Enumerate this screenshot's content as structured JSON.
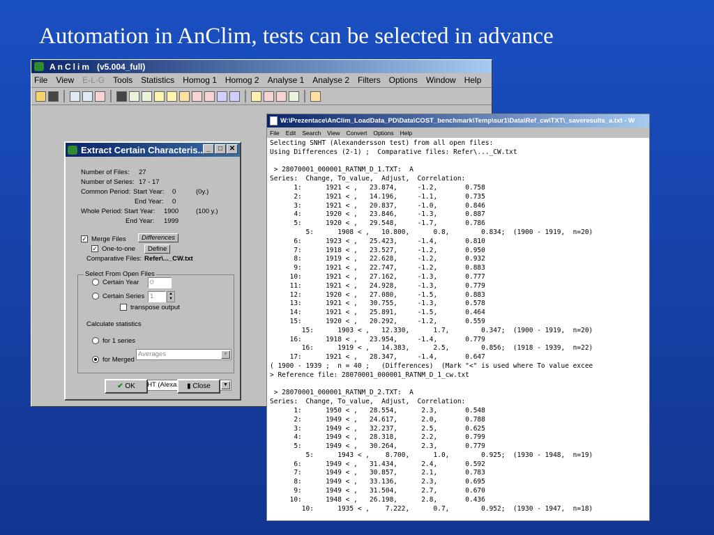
{
  "slide_title": "Automation in AnClim, tests can be selected in advance",
  "app": {
    "title_name": "AnClim",
    "title_version": "(v5.004_full)",
    "menu": [
      "File",
      "View",
      "E-L-G",
      "Tools",
      "Statistics",
      "Homog 1",
      "Homog 2",
      "Analyse 1",
      "Analyse 2",
      "Filters",
      "Options",
      "Window",
      "Help"
    ],
    "toolbar_icons": [
      "open-icon",
      "save-icon",
      "table-icon",
      "chart-icon",
      "tools-icon",
      "calculator-icon",
      "line-chart-icon",
      "graph-icon",
      "ae-icon",
      "bar-icon",
      "histogram-icon",
      "spectrum-icon",
      "grid-icon",
      "copy-icon",
      "map-icon",
      "wave-icon",
      "trend-icon",
      "monitor-icon",
      "exit-icon"
    ]
  },
  "dialog": {
    "title": "Extract Certain Characteris...",
    "number_of_files_label": "Number of Files:",
    "number_of_files": "27",
    "number_of_series_label": "Number of Series:",
    "number_of_series": "17 - 17",
    "common_period_label": "Common Period:",
    "start_year_label": "Start Year:",
    "common_start": "0",
    "common_span": "(0y.)",
    "end_year_label": "End Year:",
    "common_end": "0",
    "whole_period_label": "Whole Period:",
    "whole_start": "1900",
    "whole_span": "(100 y.)",
    "whole_end": "1999",
    "merge_files_label": "Merge Files",
    "differences_button": "Differences",
    "one_to_one_label": "One-to-one",
    "define_button": "Define",
    "comparative_files_label": "Comparative Files:",
    "comparative_files_value": "Refer\\..._CW.txt",
    "select_group_label": "Select From Open Files",
    "certain_year_label": "Certain Year",
    "certain_year_value": "0",
    "certain_series_label": "Certain Series",
    "certain_series_value": "1",
    "transpose_label": "transpose output",
    "calc_stats_label": "Calculate statistics",
    "for1_label": "for 1 series",
    "for1_value": "Averages",
    "merged_label": "for Merged",
    "merged_value": "SNHT (Alexandersson test)",
    "ok_label": "OK",
    "close_label": "Close"
  },
  "text_window": {
    "title": "W:\\Prezentace\\AnClim_LoadData_PD\\Data\\COST_benchmark\\Temp\\sur1\\Data\\Ref_cw\\TXT\\_saveresults_a.txt - W",
    "menu": [
      "File",
      "Edit",
      "Search",
      "View",
      "Convert",
      "Options",
      "Help"
    ],
    "content": "Selecting SNHT (Alexandersson test) from all open files:\nUsing Differences (2-1) ;  Comparative files: Refer\\..._CW.txt\n\n > 28070001_000001_RATNM_D_1.TXT:  A\nSeries:  Change, To_value,  Adjust,  Correlation:\n      1:      1921 < ,   23.874,     -1.2,       0.758\n      2:      1921 < ,   14.196,     -1.1,       0.735\n      3:      1921 < ,   20.837,     -1.0,       0.846\n      4:      1920 < ,   23.846,     -1.3,       0.887\n      5:      1920 < ,   29.548,     -1.7,       0.786\n         5:      1908 < ,   10.800,      0.8,        0.834;  (1900 - 1919,  n=20)\n      6:      1923 < ,   25.423,     -1.4,       0.810\n      7:      1918 < ,   23.527,     -1.2,       0.950\n      8:      1919 < ,   22.628,     -1.2,       0.932\n      9:      1921 < ,   22.747,     -1.2,       0.883\n     10:      1921 < ,   27.162,     -1.3,       0.777\n     11:      1921 < ,   24.928,     -1.3,       0.779\n     12:      1920 < ,   27.080,     -1.5,       0.883\n     13:      1921 < ,   30.755,     -1.3,       0.578\n     14:      1921 < ,   25.891,     -1.5,       0.464\n     15:      1920 < ,   20.292,     -1.2,       0.559\n        15:      1903 < ,   12.330,      1.7,        0.347;  (1900 - 1919,  n=20)\n     16:      1918 < ,   23.954,     -1.4,       0.779\n        16:      1919 < ,   14.383,      2.5,        0.856;  (1918 - 1939,  n=22)\n     17:      1921 < ,   28.347,     -1.4,       0.647\n( 1900 - 1939 ;  n = 40 ;   (Differences)  (Mark \"<\" is used where To value excee\n> Reference file: 28070001_000001_RATNM_D_1_cw.txt\n\n > 28070001_000001_RATNM_D_2.TXT:  A\nSeries:  Change, To_value,  Adjust,  Correlation:\n      1:      1950 < ,   28.554,      2.3,       0.548\n      2:      1949 < ,   24.617,      2.0,       0.788\n      3:      1949 < ,   32.237,      2.5,       0.625\n      4:      1949 < ,   28.318,      2.2,       0.799\n      5:      1949 < ,   30.264,      2.3,       0.779\n         5:      1943 < ,    8.700,      1.0,        0.925;  (1930 - 1948,  n=19)\n      6:      1949 < ,   31.434,      2.4,       0.592\n      7:      1949 < ,   30.857,      2.1,       0.783\n      8:      1949 < ,   33.136,      2.3,       0.695\n      9:      1949 < ,   31.504,      2.7,       0.670\n     10:      1948 < ,   26.198,      2.8,       0.436\n        10:      1935 < ,    7.222,      0.7,        0.952;  (1930 - 1947,  n=18)"
  }
}
